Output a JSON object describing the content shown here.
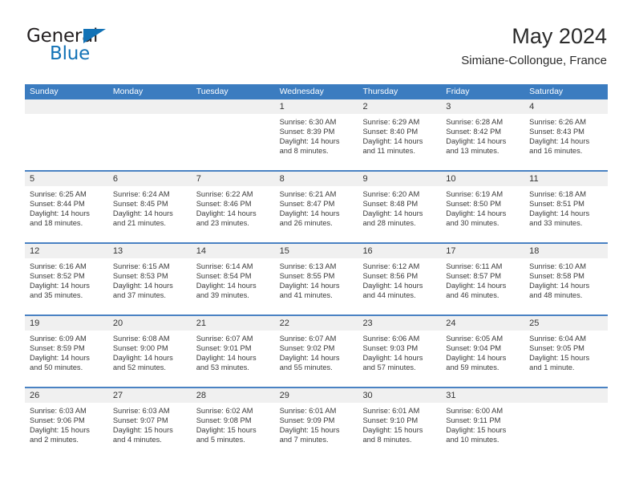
{
  "brand": {
    "name_top": "General",
    "name_bottom": "Blue",
    "triangle_icon": "blue-triangle-icon"
  },
  "header": {
    "title": "May 2024",
    "subtitle": "Simiane-Collongue, France"
  },
  "colors": {
    "header_blue": "#3b7cc0",
    "row_separator_blue": "#4a82c3",
    "daynum_band_gray": "#f0f0f0",
    "brand_blue": "#1272b6",
    "text": "#333333"
  },
  "weekdays": [
    "Sunday",
    "Monday",
    "Tuesday",
    "Wednesday",
    "Thursday",
    "Friday",
    "Saturday"
  ],
  "labels": {
    "sunrise_prefix": "Sunrise:",
    "sunset_prefix": "Sunset:",
    "daylight_prefix": "Daylight:"
  },
  "weeks": [
    [
      {
        "empty": true
      },
      {
        "empty": true
      },
      {
        "empty": true
      },
      {
        "day": "1",
        "sunrise": "Sunrise: 6:30 AM",
        "sunset": "Sunset: 8:39 PM",
        "daylight1": "Daylight: 14 hours",
        "daylight2": "and 8 minutes."
      },
      {
        "day": "2",
        "sunrise": "Sunrise: 6:29 AM",
        "sunset": "Sunset: 8:40 PM",
        "daylight1": "Daylight: 14 hours",
        "daylight2": "and 11 minutes."
      },
      {
        "day": "3",
        "sunrise": "Sunrise: 6:28 AM",
        "sunset": "Sunset: 8:42 PM",
        "daylight1": "Daylight: 14 hours",
        "daylight2": "and 13 minutes."
      },
      {
        "day": "4",
        "sunrise": "Sunrise: 6:26 AM",
        "sunset": "Sunset: 8:43 PM",
        "daylight1": "Daylight: 14 hours",
        "daylight2": "and 16 minutes."
      }
    ],
    [
      {
        "day": "5",
        "sunrise": "Sunrise: 6:25 AM",
        "sunset": "Sunset: 8:44 PM",
        "daylight1": "Daylight: 14 hours",
        "daylight2": "and 18 minutes."
      },
      {
        "day": "6",
        "sunrise": "Sunrise: 6:24 AM",
        "sunset": "Sunset: 8:45 PM",
        "daylight1": "Daylight: 14 hours",
        "daylight2": "and 21 minutes."
      },
      {
        "day": "7",
        "sunrise": "Sunrise: 6:22 AM",
        "sunset": "Sunset: 8:46 PM",
        "daylight1": "Daylight: 14 hours",
        "daylight2": "and 23 minutes."
      },
      {
        "day": "8",
        "sunrise": "Sunrise: 6:21 AM",
        "sunset": "Sunset: 8:47 PM",
        "daylight1": "Daylight: 14 hours",
        "daylight2": "and 26 minutes."
      },
      {
        "day": "9",
        "sunrise": "Sunrise: 6:20 AM",
        "sunset": "Sunset: 8:48 PM",
        "daylight1": "Daylight: 14 hours",
        "daylight2": "and 28 minutes."
      },
      {
        "day": "10",
        "sunrise": "Sunrise: 6:19 AM",
        "sunset": "Sunset: 8:50 PM",
        "daylight1": "Daylight: 14 hours",
        "daylight2": "and 30 minutes."
      },
      {
        "day": "11",
        "sunrise": "Sunrise: 6:18 AM",
        "sunset": "Sunset: 8:51 PM",
        "daylight1": "Daylight: 14 hours",
        "daylight2": "and 33 minutes."
      }
    ],
    [
      {
        "day": "12",
        "sunrise": "Sunrise: 6:16 AM",
        "sunset": "Sunset: 8:52 PM",
        "daylight1": "Daylight: 14 hours",
        "daylight2": "and 35 minutes."
      },
      {
        "day": "13",
        "sunrise": "Sunrise: 6:15 AM",
        "sunset": "Sunset: 8:53 PM",
        "daylight1": "Daylight: 14 hours",
        "daylight2": "and 37 minutes."
      },
      {
        "day": "14",
        "sunrise": "Sunrise: 6:14 AM",
        "sunset": "Sunset: 8:54 PM",
        "daylight1": "Daylight: 14 hours",
        "daylight2": "and 39 minutes."
      },
      {
        "day": "15",
        "sunrise": "Sunrise: 6:13 AM",
        "sunset": "Sunset: 8:55 PM",
        "daylight1": "Daylight: 14 hours",
        "daylight2": "and 41 minutes."
      },
      {
        "day": "16",
        "sunrise": "Sunrise: 6:12 AM",
        "sunset": "Sunset: 8:56 PM",
        "daylight1": "Daylight: 14 hours",
        "daylight2": "and 44 minutes."
      },
      {
        "day": "17",
        "sunrise": "Sunrise: 6:11 AM",
        "sunset": "Sunset: 8:57 PM",
        "daylight1": "Daylight: 14 hours",
        "daylight2": "and 46 minutes."
      },
      {
        "day": "18",
        "sunrise": "Sunrise: 6:10 AM",
        "sunset": "Sunset: 8:58 PM",
        "daylight1": "Daylight: 14 hours",
        "daylight2": "and 48 minutes."
      }
    ],
    [
      {
        "day": "19",
        "sunrise": "Sunrise: 6:09 AM",
        "sunset": "Sunset: 8:59 PM",
        "daylight1": "Daylight: 14 hours",
        "daylight2": "and 50 minutes."
      },
      {
        "day": "20",
        "sunrise": "Sunrise: 6:08 AM",
        "sunset": "Sunset: 9:00 PM",
        "daylight1": "Daylight: 14 hours",
        "daylight2": "and 52 minutes."
      },
      {
        "day": "21",
        "sunrise": "Sunrise: 6:07 AM",
        "sunset": "Sunset: 9:01 PM",
        "daylight1": "Daylight: 14 hours",
        "daylight2": "and 53 minutes."
      },
      {
        "day": "22",
        "sunrise": "Sunrise: 6:07 AM",
        "sunset": "Sunset: 9:02 PM",
        "daylight1": "Daylight: 14 hours",
        "daylight2": "and 55 minutes."
      },
      {
        "day": "23",
        "sunrise": "Sunrise: 6:06 AM",
        "sunset": "Sunset: 9:03 PM",
        "daylight1": "Daylight: 14 hours",
        "daylight2": "and 57 minutes."
      },
      {
        "day": "24",
        "sunrise": "Sunrise: 6:05 AM",
        "sunset": "Sunset: 9:04 PM",
        "daylight1": "Daylight: 14 hours",
        "daylight2": "and 59 minutes."
      },
      {
        "day": "25",
        "sunrise": "Sunrise: 6:04 AM",
        "sunset": "Sunset: 9:05 PM",
        "daylight1": "Daylight: 15 hours",
        "daylight2": "and 1 minute."
      }
    ],
    [
      {
        "day": "26",
        "sunrise": "Sunrise: 6:03 AM",
        "sunset": "Sunset: 9:06 PM",
        "daylight1": "Daylight: 15 hours",
        "daylight2": "and 2 minutes."
      },
      {
        "day": "27",
        "sunrise": "Sunrise: 6:03 AM",
        "sunset": "Sunset: 9:07 PM",
        "daylight1": "Daylight: 15 hours",
        "daylight2": "and 4 minutes."
      },
      {
        "day": "28",
        "sunrise": "Sunrise: 6:02 AM",
        "sunset": "Sunset: 9:08 PM",
        "daylight1": "Daylight: 15 hours",
        "daylight2": "and 5 minutes."
      },
      {
        "day": "29",
        "sunrise": "Sunrise: 6:01 AM",
        "sunset": "Sunset: 9:09 PM",
        "daylight1": "Daylight: 15 hours",
        "daylight2": "and 7 minutes."
      },
      {
        "day": "30",
        "sunrise": "Sunrise: 6:01 AM",
        "sunset": "Sunset: 9:10 PM",
        "daylight1": "Daylight: 15 hours",
        "daylight2": "and 8 minutes."
      },
      {
        "day": "31",
        "sunrise": "Sunrise: 6:00 AM",
        "sunset": "Sunset: 9:11 PM",
        "daylight1": "Daylight: 15 hours",
        "daylight2": "and 10 minutes."
      },
      {
        "empty": true
      }
    ]
  ]
}
